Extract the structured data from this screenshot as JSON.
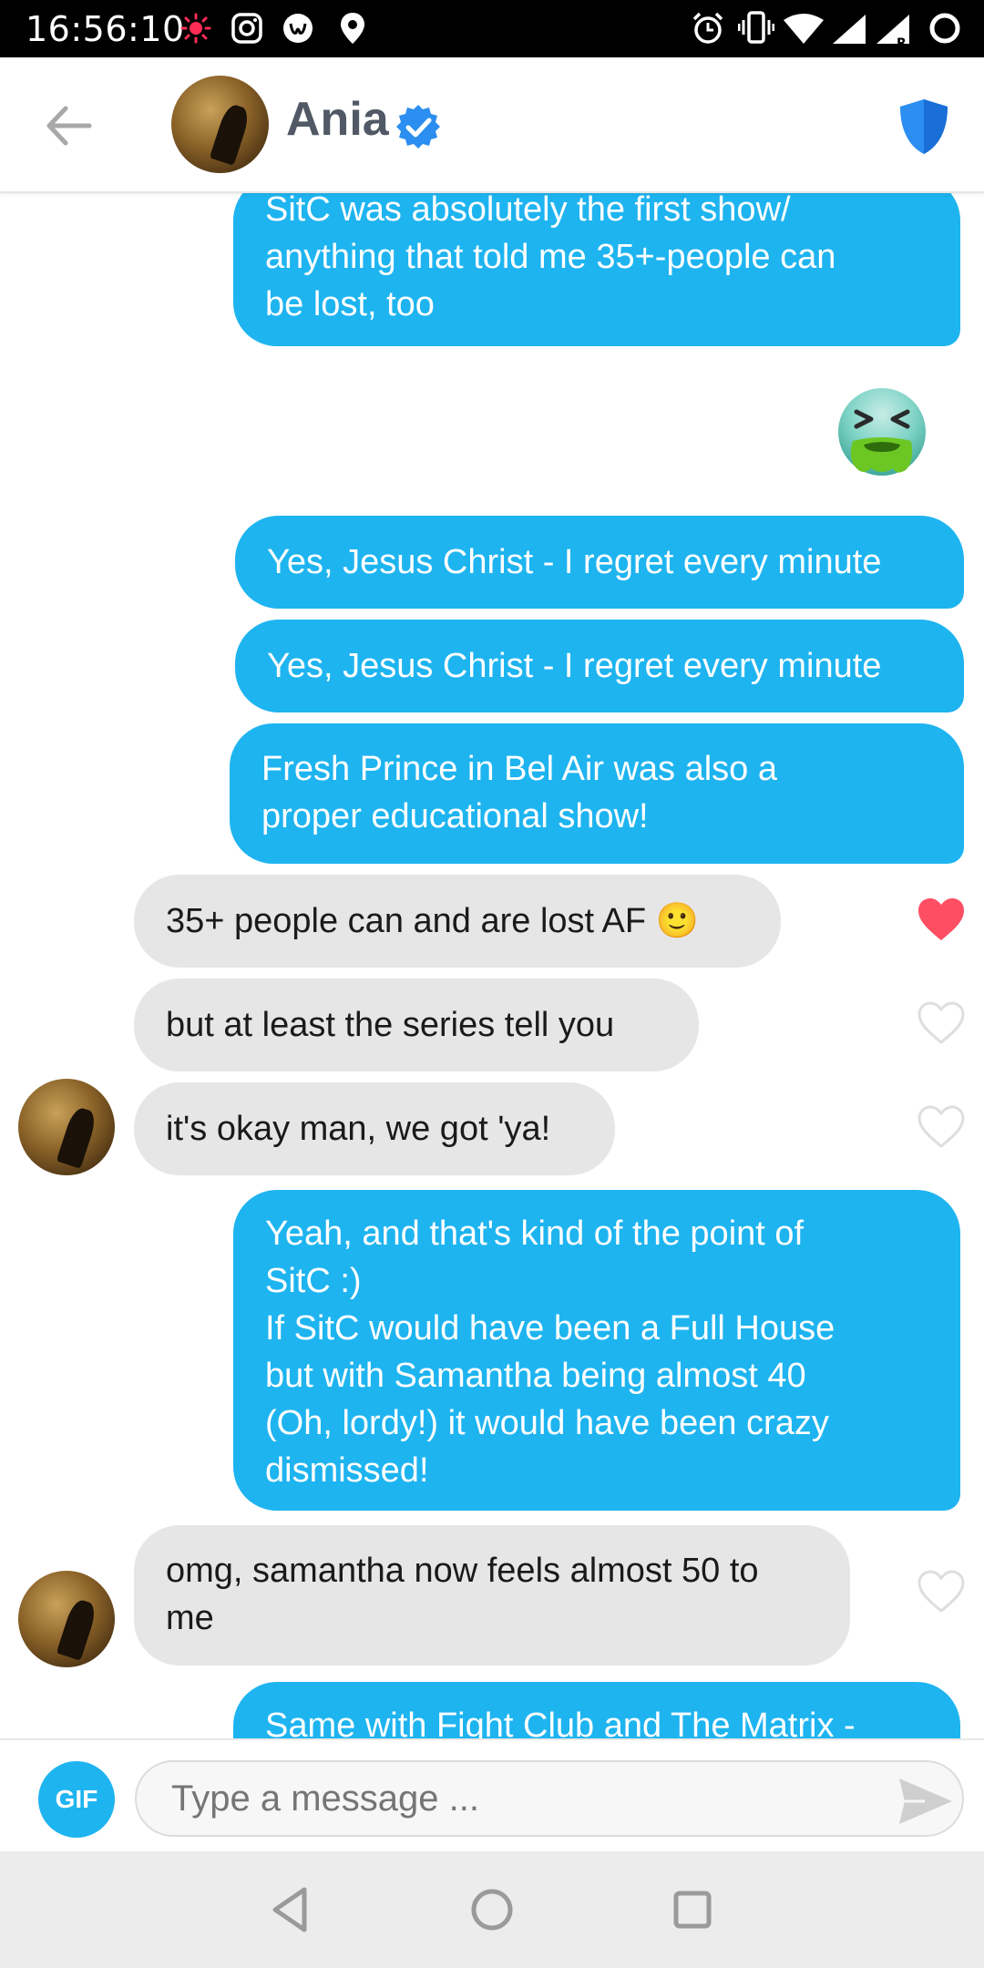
{
  "status_bar": {
    "time": "16:56:10"
  },
  "header": {
    "contact_name": "Ania",
    "icons": [
      "back-arrow-icon",
      "verified-badge-icon",
      "shield-icon"
    ]
  },
  "messages": [
    {
      "side": "out",
      "lines": [
        "SitC was absolutely the first show/",
        "anything that told me 35+-people can",
        "be lost, too"
      ]
    },
    {
      "side": "out",
      "type": "emoji",
      "emoji": "🤮"
    },
    {
      "side": "out",
      "lines": [
        "Yes, Jesus Christ - I regret every minute"
      ]
    },
    {
      "side": "out",
      "lines": [
        "Yes, Jesus Christ - I regret every minute"
      ]
    },
    {
      "side": "out",
      "lines": [
        "Fresh Prince in Bel Air was also a",
        "proper educational show!"
      ]
    },
    {
      "side": "in",
      "lines": [
        "35+ people can and are lost AF 🙂"
      ],
      "liked": true
    },
    {
      "side": "in",
      "lines": [
        "but at least the series tell you"
      ],
      "liked": false
    },
    {
      "side": "in",
      "lines": [
        "it's okay man, we got 'ya!"
      ],
      "liked": false
    },
    {
      "side": "out",
      "lines": [
        "Yeah, and that's kind of the point of",
        "SitC :)",
        "If SitC would have been a Full House",
        "but with Samantha being almost 40",
        "(Oh, lordy!) it would have been crazy",
        "dismissed!"
      ]
    },
    {
      "side": "in",
      "lines": [
        "omg, samantha now feels almost 50 to",
        "me"
      ],
      "liked": false
    },
    {
      "side": "out",
      "lines": [
        "Same with Fight Club and The Matrix -"
      ]
    }
  ],
  "input": {
    "gif_label": "GIF",
    "placeholder": "Type a message ..."
  },
  "colors": {
    "outgoing_bubble": "#1eb4f0",
    "incoming_bubble": "#e6e6e6",
    "heart_liked": "#fd4e63",
    "verified": "#2b8ef0"
  }
}
